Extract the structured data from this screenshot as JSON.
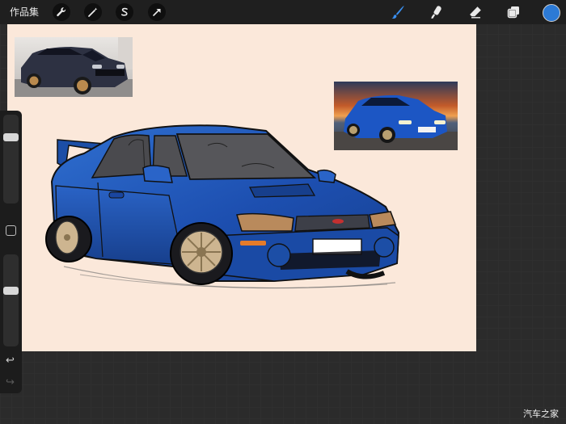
{
  "app": {
    "gallery_label": "作品集"
  },
  "toolbar_left": [
    {
      "name": "actions-wrench-icon"
    },
    {
      "name": "adjustments-wand-icon"
    },
    {
      "name": "selection-s-icon"
    },
    {
      "name": "transform-arrow-icon"
    }
  ],
  "toolbar_right": [
    {
      "name": "brush-icon",
      "active": true
    },
    {
      "name": "smudge-icon"
    },
    {
      "name": "eraser-icon"
    },
    {
      "name": "layers-icon"
    }
  ],
  "colors": {
    "current_color": "#2c7ad6",
    "canvas_background": "#fbe8da",
    "car_blue": "#1f56b8",
    "ui_dark": "#1f1f1f"
  },
  "sidebar": {
    "brush_size_level": 0.77,
    "brush_opacity_level": 0.62,
    "undo_symbol": "↩",
    "redo_symbol": "↪"
  },
  "watermark": {
    "text": "汽车之家"
  }
}
